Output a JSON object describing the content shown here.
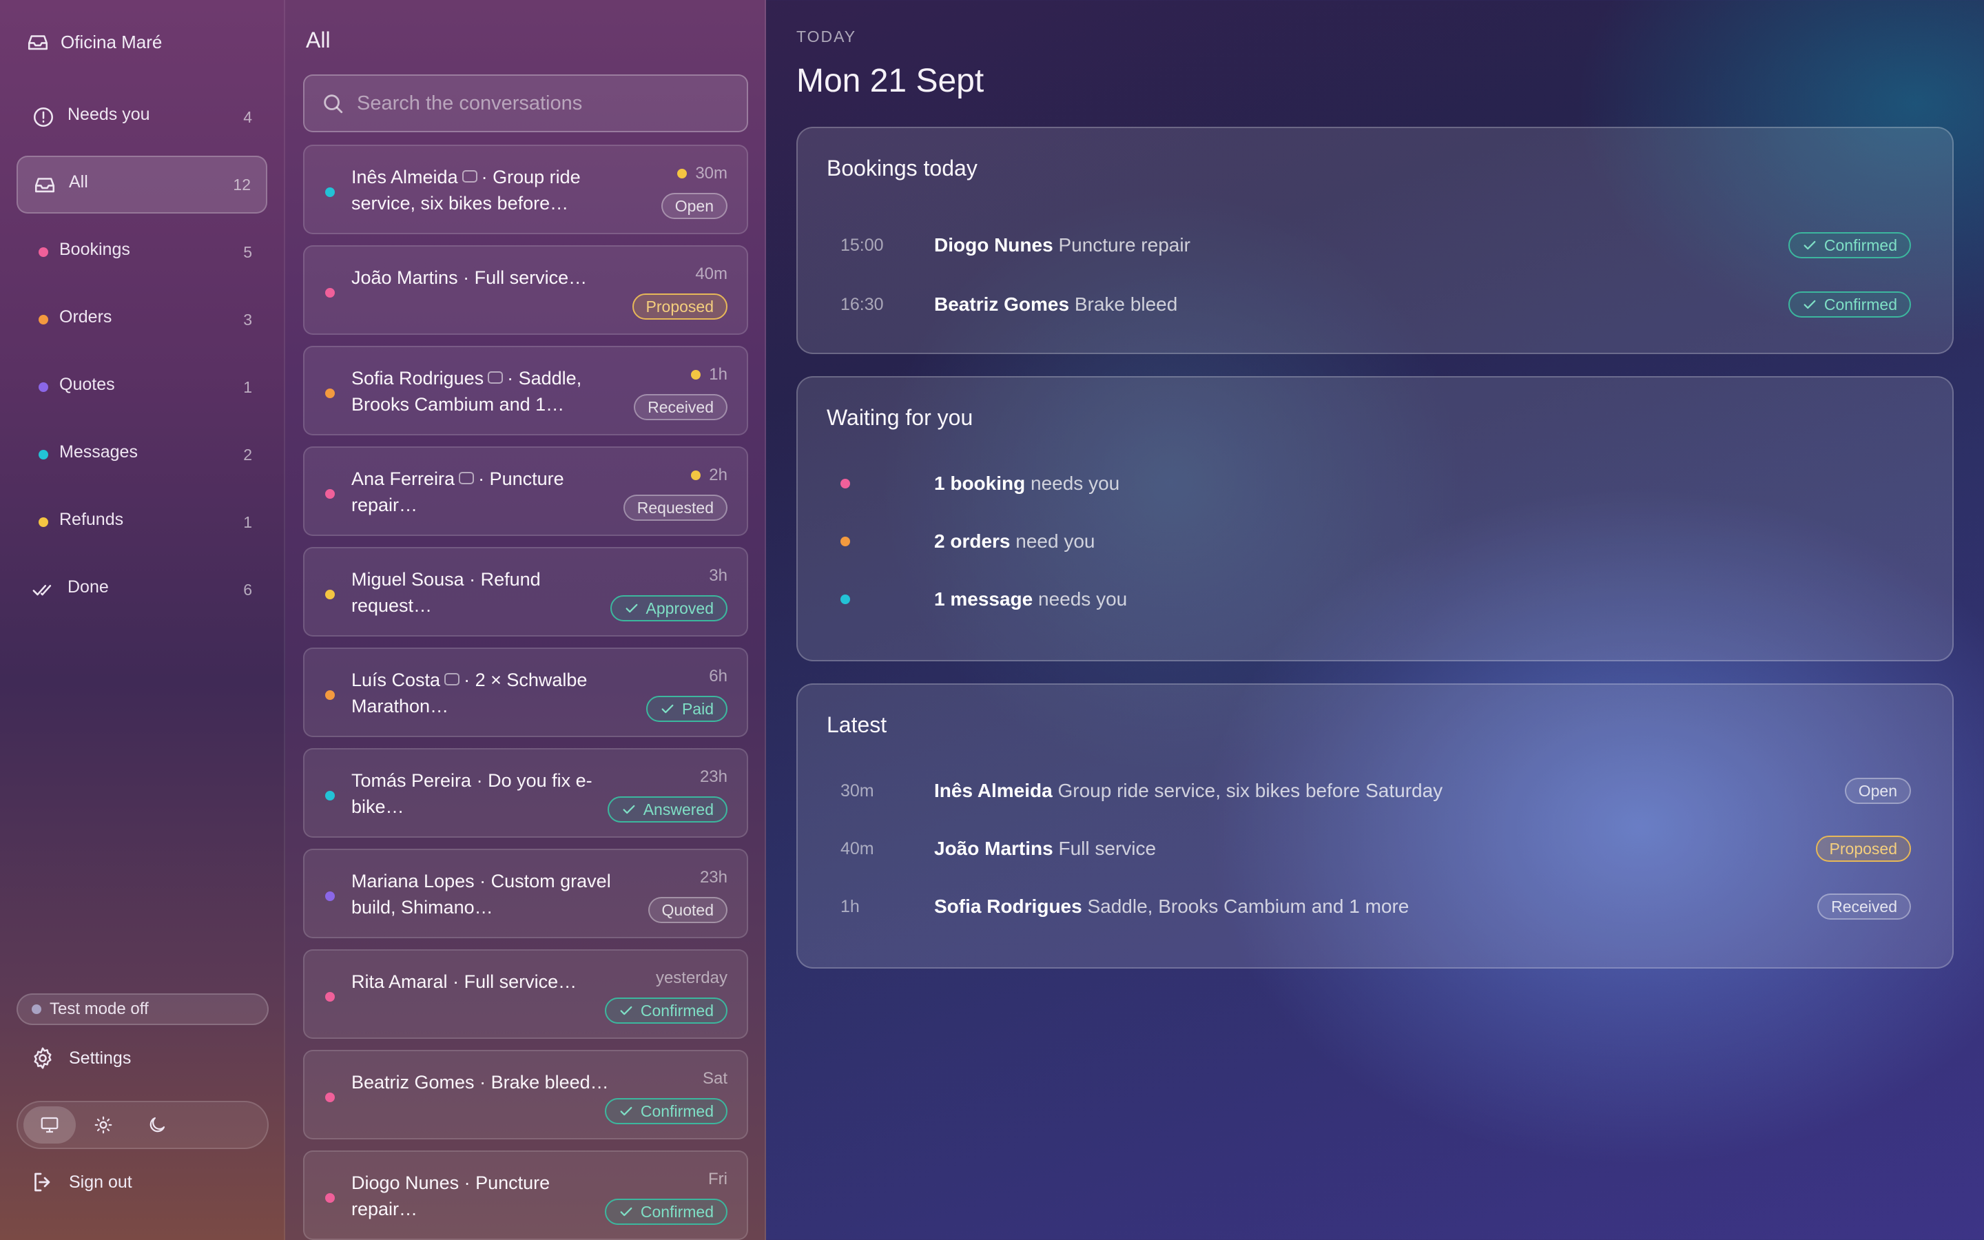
{
  "sidebar": {
    "brand": "Oficina Maré",
    "items": [
      {
        "label": "Needs you",
        "count": "4"
      },
      {
        "label": "All",
        "count": "12"
      },
      {
        "label": "Bookings",
        "count": "5",
        "color": "#f0609a"
      },
      {
        "label": "Orders",
        "count": "3",
        "color": "#f39a3f"
      },
      {
        "label": "Quotes",
        "count": "1",
        "color": "#8b67e8"
      },
      {
        "label": "Messages",
        "count": "2",
        "color": "#23c2d6"
      },
      {
        "label": "Refunds",
        "count": "1",
        "color": "#f4c542"
      },
      {
        "label": "Done",
        "count": "6"
      }
    ],
    "test_mode": "Test mode off",
    "settings": "Settings",
    "sign_out": "Sign out"
  },
  "list": {
    "title": "All",
    "search_placeholder": "Search the conversations",
    "cards": [
      {
        "name": "Inês Almeida",
        "rest": "· Group ride service, six bikes before…",
        "time": "30m",
        "badge": "Open",
        "dot": "#23c2d6"
      },
      {
        "name": "João Martins",
        "rest": "· Full service…",
        "time": "40m",
        "badge": "Proposed",
        "dot": "#f0609a"
      },
      {
        "name": "Sofia Rodrigues",
        "rest": "· Saddle, Brooks Cambium and 1…",
        "time": "1h",
        "badge": "Received",
        "dot": "#f39a3f"
      },
      {
        "name": "Ana Ferreira",
        "rest": "· Puncture repair…",
        "time": "2h",
        "badge": "Requested",
        "dot": "#f0609a"
      },
      {
        "name": "Miguel Sousa",
        "rest": "· Refund request…",
        "time": "3h",
        "badge": "Approved",
        "dot": "#f4c542"
      },
      {
        "name": "Luís Costa",
        "rest": "· 2 × Schwalbe Marathon…",
        "time": "6h",
        "badge": "Paid",
        "dot": "#f39a3f"
      },
      {
        "name": "Tomás Pereira",
        "rest": "· Do you fix e-bike…",
        "time": "23h",
        "badge": "Answered",
        "dot": "#23c2d6"
      },
      {
        "name": "Mariana Lopes",
        "rest": "· Custom gravel build, Shimano…",
        "time": "23h",
        "badge": "Quoted",
        "dot": "#8b67e8"
      },
      {
        "name": "Rita Amaral",
        "rest": "· Full service…",
        "time": "yesterday",
        "badge": "Confirmed",
        "dot": "#f0609a"
      },
      {
        "name": "Beatriz Gomes",
        "rest": "· Brake bleed…",
        "time": "Sat",
        "badge": "Confirmed",
        "dot": "#f0609a"
      },
      {
        "name": "Diogo Nunes",
        "rest": "· Puncture repair…",
        "time": "Fri",
        "badge": "Confirmed",
        "dot": "#f0609a"
      }
    ]
  },
  "main": {
    "today_label": "TODAY",
    "date": "Mon 21 Sept",
    "bookings": {
      "title": "Bookings today",
      "rows": [
        {
          "time": "15:00",
          "name": "Diogo Nunes",
          "desc": "Puncture repair",
          "badge": "Confirmed"
        },
        {
          "time": "16:30",
          "name": "Beatriz Gomes",
          "desc": "Brake bleed",
          "badge": "Confirmed"
        }
      ]
    },
    "waiting": {
      "title": "Waiting for you",
      "rows": [
        {
          "bold": "1 booking",
          "rest": "needs you",
          "color": "#f0609a"
        },
        {
          "bold": "2 orders",
          "rest": "need you",
          "color": "#f39a3f"
        },
        {
          "bold": "1 message",
          "rest": "needs you",
          "color": "#23c2d6"
        }
      ]
    },
    "latest": {
      "title": "Latest",
      "rows": [
        {
          "time": "30m",
          "name": "Inês Almeida",
          "desc": "Group ride service, six bikes before Saturday",
          "badge": "Open"
        },
        {
          "time": "40m",
          "name": "João Martins",
          "desc": "Full service",
          "badge": "Proposed"
        },
        {
          "time": "1h",
          "name": "Sofia Rodrigues",
          "desc": "Saddle, Brooks Cambium and 1 more",
          "badge": "Received"
        }
      ]
    }
  }
}
